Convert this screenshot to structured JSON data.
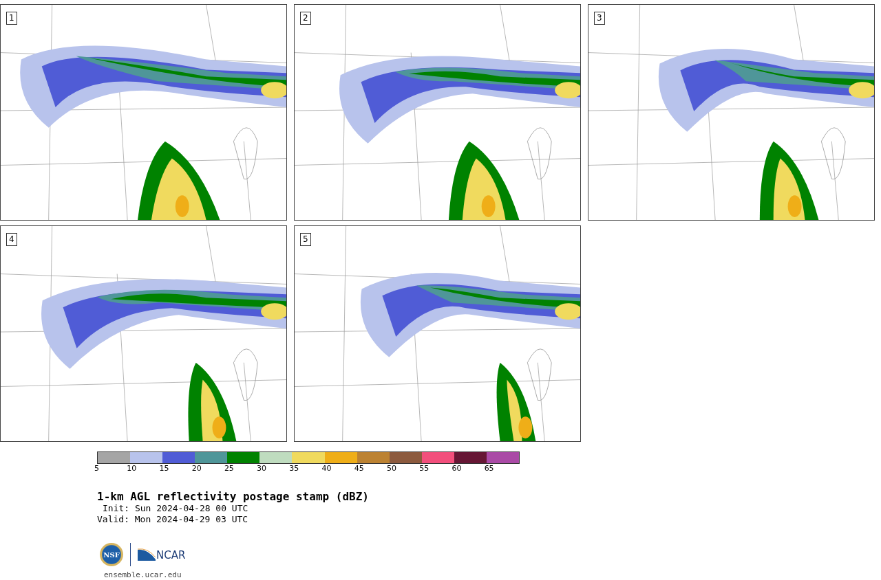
{
  "panels": [
    {
      "label": "1"
    },
    {
      "label": "2"
    },
    {
      "label": "3"
    },
    {
      "label": "4"
    },
    {
      "label": "5"
    }
  ],
  "colorbar": {
    "bins": [
      {
        "color": "#a5a5a5"
      },
      {
        "color": "#b8c3ec"
      },
      {
        "color": "#505cd6"
      },
      {
        "color": "#4f9699"
      },
      {
        "color": "#008200"
      },
      {
        "color": "#bfdcbf"
      },
      {
        "color": "#f0da5e"
      },
      {
        "color": "#efae18"
      },
      {
        "color": "#bc8232"
      },
      {
        "color": "#8c5a3e"
      },
      {
        "color": "#f24f7c"
      },
      {
        "color": "#661634"
      },
      {
        "color": "#aa4aa6"
      }
    ],
    "ticks": [
      "5",
      "10",
      "15",
      "20",
      "25",
      "30",
      "35",
      "40",
      "45",
      "50",
      "55",
      "60",
      "65"
    ]
  },
  "title": "1-km AGL reflectivity postage stamp (dBZ)",
  "init": "Init: Sun 2024-04-28 00 UTC",
  "valid": "Valid: Mon 2024-04-29 03 UTC",
  "logos": {
    "nsf": "NSF",
    "ncar": "NCAR"
  },
  "website": "ensemble.ucar.edu"
}
